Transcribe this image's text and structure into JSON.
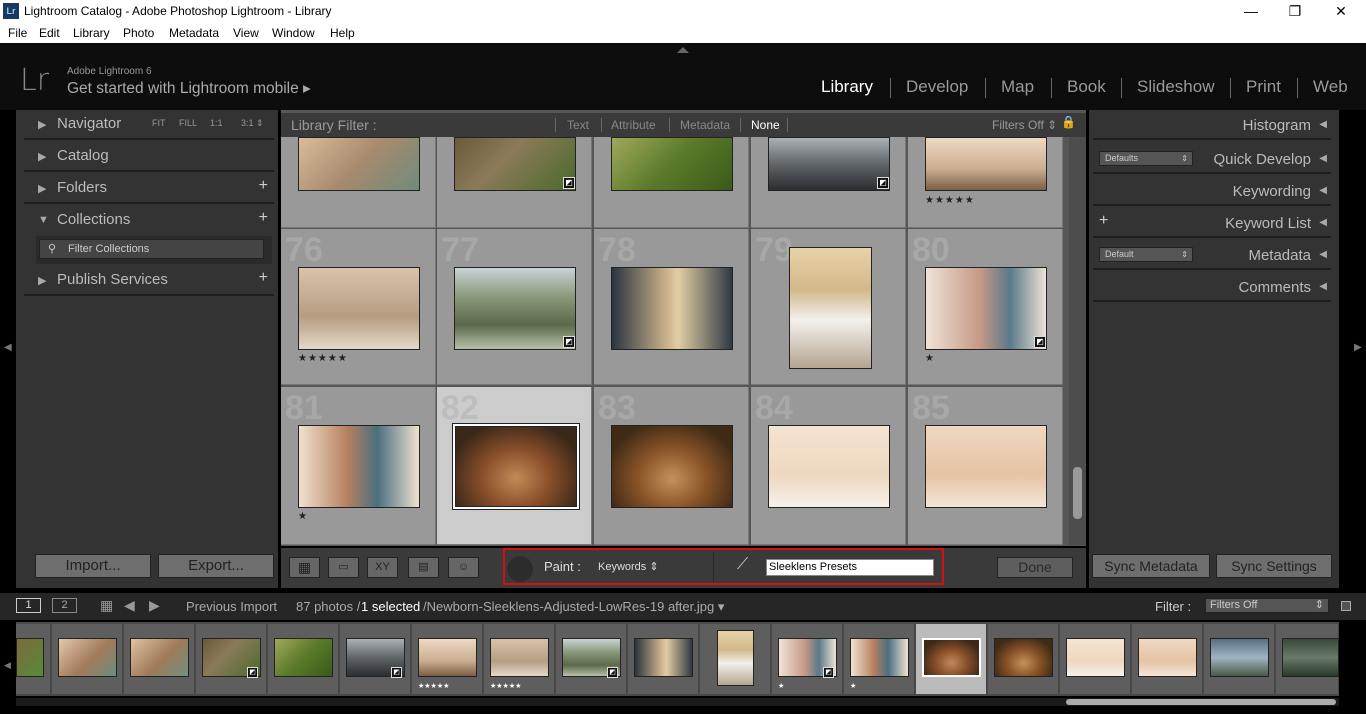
{
  "window": {
    "app_icon": "Lr",
    "title": "Lightroom Catalog - Adobe Photoshop Lightroom - Library",
    "minimize": "—",
    "maximize": "❐",
    "close": "✕"
  },
  "menu": [
    "File",
    "Edit",
    "Library",
    "Photo",
    "Metadata",
    "View",
    "Window",
    "Help"
  ],
  "identity": {
    "logo": "Lr",
    "version": "Adobe Lightroom 6",
    "mobile": "Get started with Lightroom mobile ▸"
  },
  "modules": [
    "Library",
    "Develop",
    "Map",
    "Book",
    "Slideshow",
    "Print",
    "Web"
  ],
  "active_module": "Library",
  "left_panel": {
    "navigator": {
      "label": "Navigator",
      "zoom": [
        "FIT",
        "FILL",
        "1:1",
        "3:1 ⇕"
      ]
    },
    "catalog": "Catalog",
    "folders": "Folders",
    "collections": "Collections",
    "filter_collections": "Filter Collections",
    "publish_services": "Publish Services",
    "import": "Import...",
    "export": "Export..."
  },
  "filter_bar": {
    "label": "Library Filter :",
    "options": [
      "Text",
      "Attribute",
      "Metadata",
      "None"
    ],
    "active": "None",
    "filters_off": "Filters Off ⇕"
  },
  "grid_rows": [
    {
      "numbers": [
        "",
        "",
        "",
        "",
        ""
      ],
      "stars": [
        "",
        "",
        "",
        "",
        "★★★★★"
      ]
    },
    {
      "numbers": [
        "76",
        "77",
        "78",
        "79",
        "80"
      ],
      "stars": [
        "★★★★★",
        "",
        "",
        "",
        "★"
      ]
    },
    {
      "numbers": [
        "81",
        "82",
        "83",
        "84",
        "85"
      ],
      "stars": [
        "★",
        "",
        "",
        "",
        ""
      ]
    }
  ],
  "toolbar": {
    "paint_label": "Paint :",
    "paint_mode": "Keywords ⇕",
    "keyword_value": "Sleeklens Presets",
    "done": "Done"
  },
  "right_panel": {
    "histogram": "Histogram",
    "quick_develop": "Quick Develop",
    "quick_develop_preset": "Defaults",
    "keywording": "Keywording",
    "keyword_list": "Keyword List",
    "metadata": "Metadata",
    "metadata_preset": "Default",
    "comments": "Comments",
    "sync_metadata": "Sync Metadata",
    "sync_settings": "Sync Settings"
  },
  "filmstrip_bar": {
    "page1": "1",
    "page2": "2",
    "source": "Previous Import",
    "count": "87 photos /",
    "selected": "1 selected",
    "filename": "/Newborn-Sleeklens-Adjusted-LowRes-19 after.jpg ▾",
    "filter_label": "Filter :",
    "filter_value": "Filters Off"
  },
  "filmstrip_stars": [
    "",
    "",
    "",
    "",
    "",
    "",
    "★★★★★",
    "★★★★★",
    "",
    "",
    "",
    "★",
    "★",
    "",
    "",
    "",
    "",
    "",
    ""
  ],
  "colors": {
    "selection_outline": "#d41111",
    "active_module": "#ffffff"
  }
}
